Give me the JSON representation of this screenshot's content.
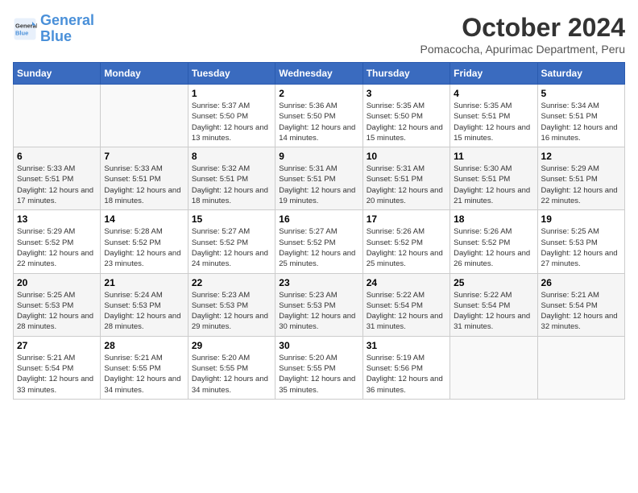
{
  "logo": {
    "line1": "General",
    "line2": "Blue"
  },
  "title": "October 2024",
  "subtitle": "Pomacocha, Apurimac Department, Peru",
  "days_of_week": [
    "Sunday",
    "Monday",
    "Tuesday",
    "Wednesday",
    "Thursday",
    "Friday",
    "Saturday"
  ],
  "weeks": [
    [
      {
        "day": "",
        "info": ""
      },
      {
        "day": "",
        "info": ""
      },
      {
        "day": "1",
        "info": "Sunrise: 5:37 AM\nSunset: 5:50 PM\nDaylight: 12 hours and 13 minutes."
      },
      {
        "day": "2",
        "info": "Sunrise: 5:36 AM\nSunset: 5:50 PM\nDaylight: 12 hours and 14 minutes."
      },
      {
        "day": "3",
        "info": "Sunrise: 5:35 AM\nSunset: 5:50 PM\nDaylight: 12 hours and 15 minutes."
      },
      {
        "day": "4",
        "info": "Sunrise: 5:35 AM\nSunset: 5:51 PM\nDaylight: 12 hours and 15 minutes."
      },
      {
        "day": "5",
        "info": "Sunrise: 5:34 AM\nSunset: 5:51 PM\nDaylight: 12 hours and 16 minutes."
      }
    ],
    [
      {
        "day": "6",
        "info": "Sunrise: 5:33 AM\nSunset: 5:51 PM\nDaylight: 12 hours and 17 minutes."
      },
      {
        "day": "7",
        "info": "Sunrise: 5:33 AM\nSunset: 5:51 PM\nDaylight: 12 hours and 18 minutes."
      },
      {
        "day": "8",
        "info": "Sunrise: 5:32 AM\nSunset: 5:51 PM\nDaylight: 12 hours and 18 minutes."
      },
      {
        "day": "9",
        "info": "Sunrise: 5:31 AM\nSunset: 5:51 PM\nDaylight: 12 hours and 19 minutes."
      },
      {
        "day": "10",
        "info": "Sunrise: 5:31 AM\nSunset: 5:51 PM\nDaylight: 12 hours and 20 minutes."
      },
      {
        "day": "11",
        "info": "Sunrise: 5:30 AM\nSunset: 5:51 PM\nDaylight: 12 hours and 21 minutes."
      },
      {
        "day": "12",
        "info": "Sunrise: 5:29 AM\nSunset: 5:51 PM\nDaylight: 12 hours and 22 minutes."
      }
    ],
    [
      {
        "day": "13",
        "info": "Sunrise: 5:29 AM\nSunset: 5:52 PM\nDaylight: 12 hours and 22 minutes."
      },
      {
        "day": "14",
        "info": "Sunrise: 5:28 AM\nSunset: 5:52 PM\nDaylight: 12 hours and 23 minutes."
      },
      {
        "day": "15",
        "info": "Sunrise: 5:27 AM\nSunset: 5:52 PM\nDaylight: 12 hours and 24 minutes."
      },
      {
        "day": "16",
        "info": "Sunrise: 5:27 AM\nSunset: 5:52 PM\nDaylight: 12 hours and 25 minutes."
      },
      {
        "day": "17",
        "info": "Sunrise: 5:26 AM\nSunset: 5:52 PM\nDaylight: 12 hours and 25 minutes."
      },
      {
        "day": "18",
        "info": "Sunrise: 5:26 AM\nSunset: 5:52 PM\nDaylight: 12 hours and 26 minutes."
      },
      {
        "day": "19",
        "info": "Sunrise: 5:25 AM\nSunset: 5:53 PM\nDaylight: 12 hours and 27 minutes."
      }
    ],
    [
      {
        "day": "20",
        "info": "Sunrise: 5:25 AM\nSunset: 5:53 PM\nDaylight: 12 hours and 28 minutes."
      },
      {
        "day": "21",
        "info": "Sunrise: 5:24 AM\nSunset: 5:53 PM\nDaylight: 12 hours and 28 minutes."
      },
      {
        "day": "22",
        "info": "Sunrise: 5:23 AM\nSunset: 5:53 PM\nDaylight: 12 hours and 29 minutes."
      },
      {
        "day": "23",
        "info": "Sunrise: 5:23 AM\nSunset: 5:53 PM\nDaylight: 12 hours and 30 minutes."
      },
      {
        "day": "24",
        "info": "Sunrise: 5:22 AM\nSunset: 5:54 PM\nDaylight: 12 hours and 31 minutes."
      },
      {
        "day": "25",
        "info": "Sunrise: 5:22 AM\nSunset: 5:54 PM\nDaylight: 12 hours and 31 minutes."
      },
      {
        "day": "26",
        "info": "Sunrise: 5:21 AM\nSunset: 5:54 PM\nDaylight: 12 hours and 32 minutes."
      }
    ],
    [
      {
        "day": "27",
        "info": "Sunrise: 5:21 AM\nSunset: 5:54 PM\nDaylight: 12 hours and 33 minutes."
      },
      {
        "day": "28",
        "info": "Sunrise: 5:21 AM\nSunset: 5:55 PM\nDaylight: 12 hours and 34 minutes."
      },
      {
        "day": "29",
        "info": "Sunrise: 5:20 AM\nSunset: 5:55 PM\nDaylight: 12 hours and 34 minutes."
      },
      {
        "day": "30",
        "info": "Sunrise: 5:20 AM\nSunset: 5:55 PM\nDaylight: 12 hours and 35 minutes."
      },
      {
        "day": "31",
        "info": "Sunrise: 5:19 AM\nSunset: 5:56 PM\nDaylight: 12 hours and 36 minutes."
      },
      {
        "day": "",
        "info": ""
      },
      {
        "day": "",
        "info": ""
      }
    ]
  ]
}
